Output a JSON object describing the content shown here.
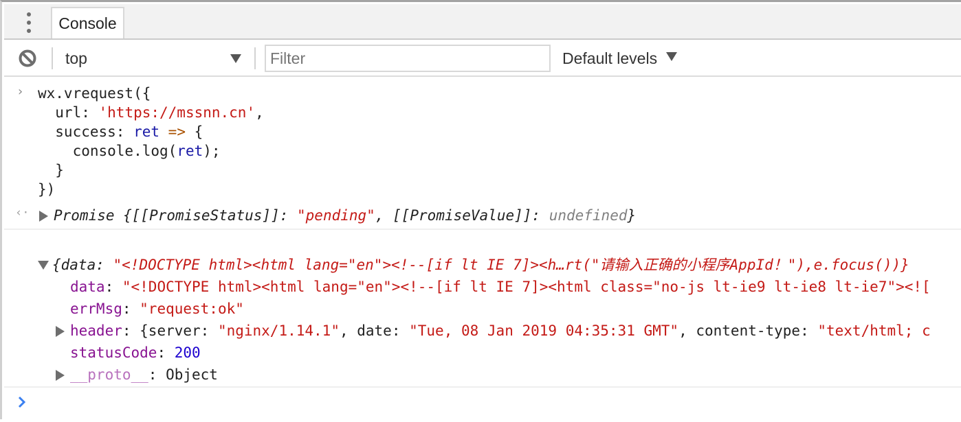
{
  "tabbar": {
    "menu_icon": "more-vertical-icon",
    "tabs": [
      {
        "label": "Console",
        "active": true
      }
    ]
  },
  "toolbar": {
    "clear_icon": "block-icon",
    "context": "top",
    "filter": {
      "value": "",
      "placeholder": "Filter"
    },
    "levels": "Default levels"
  },
  "console": {
    "input": {
      "lines": [
        [
          {
            "t": "wx.vrequest({",
            "c": "default"
          }
        ],
        [
          {
            "t": "  url: ",
            "c": "default"
          },
          {
            "t": "'https://mssnn.cn'",
            "c": "str"
          },
          {
            "t": ",",
            "c": "default"
          }
        ],
        [
          {
            "t": "  success: ",
            "c": "default"
          },
          {
            "t": "ret",
            "c": "var"
          },
          {
            "t": " ",
            "c": "default"
          },
          {
            "t": "=>",
            "c": "op"
          },
          {
            "t": " {",
            "c": "default"
          }
        ],
        [
          {
            "t": "    console.log(",
            "c": "default"
          },
          {
            "t": "ret",
            "c": "var"
          },
          {
            "t": ");",
            "c": "default"
          }
        ],
        [
          {
            "t": "  }",
            "c": "default"
          }
        ],
        [
          {
            "t": "})",
            "c": "default"
          }
        ]
      ]
    },
    "result": {
      "segments": [
        {
          "t": "Promise {[[PromiseStatus]]: ",
          "c": "default"
        },
        {
          "t": "\"pending\"",
          "c": "str"
        },
        {
          "t": ", [[PromiseValue]]: ",
          "c": "default"
        },
        {
          "t": "undefined",
          "c": "undef"
        },
        {
          "t": "}",
          "c": "default"
        }
      ]
    },
    "log": {
      "summary": [
        {
          "t": "{data: ",
          "c": "default"
        },
        {
          "t": "\"<!DOCTYPE html><html lang=\"en\"><!--[if lt IE 7]><h…rt(\"请输入正确的小程序AppId！\"),e.focus())}",
          "c": "str"
        }
      ],
      "props": [
        {
          "key": "data",
          "expandable": false,
          "value": [
            {
              "t": "\"<!DOCTYPE html><html lang=\"en\"><!--[if lt IE 7]><html class=\"no-js lt-ie9 lt-ie8 lt-ie7\"><![",
              "c": "str"
            }
          ]
        },
        {
          "key": "errMsg",
          "expandable": false,
          "value": [
            {
              "t": "\"request:ok\"",
              "c": "str"
            }
          ]
        },
        {
          "key": "header",
          "expandable": true,
          "value": [
            {
              "t": "{server: ",
              "c": "default"
            },
            {
              "t": "\"nginx/1.14.1\"",
              "c": "str"
            },
            {
              "t": ", date: ",
              "c": "default"
            },
            {
              "t": "\"Tue, 08 Jan 2019 04:35:31 GMT\"",
              "c": "str"
            },
            {
              "t": ", content-type: ",
              "c": "default"
            },
            {
              "t": "\"text/html; c",
              "c": "str"
            }
          ]
        },
        {
          "key": "statusCode",
          "expandable": false,
          "value": [
            {
              "t": "200",
              "c": "num"
            }
          ]
        },
        {
          "key": "__proto__",
          "expandable": true,
          "dim": true,
          "value": [
            {
              "t": "Object",
              "c": "default"
            }
          ]
        }
      ]
    },
    "prompt_icon": "chevron-right-icon"
  }
}
